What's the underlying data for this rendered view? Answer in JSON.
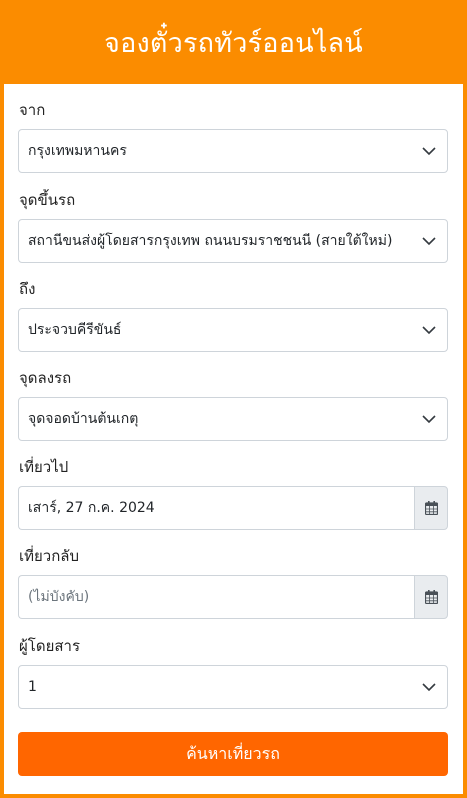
{
  "header": {
    "title": "จองตั๋วรถทัวร์ออนไลน์"
  },
  "form": {
    "from": {
      "label": "จาก",
      "value": "กรุงเทพมหานคร"
    },
    "pickup": {
      "label": "จุดขึ้นรถ",
      "value": "สถานีขนส่งผู้โดยสารกรุงเทพ ถนนบรมราชชนนี (สายใต้ใหม่)"
    },
    "to": {
      "label": "ถึง",
      "value": "ประจวบคีรีขันธ์"
    },
    "dropoff": {
      "label": "จุดลงรถ",
      "value": "จุดจอดบ้านต้นเกตุ"
    },
    "depart": {
      "label": "เที่ยวไป",
      "value": "เสาร์, 27 ก.ค. 2024"
    },
    "return": {
      "label": "เที่ยวกลับ",
      "placeholder": "(ไม่บังคับ)"
    },
    "passengers": {
      "label": "ผู้โดยสาร",
      "value": "1"
    },
    "search_label": "ค้นหาเที่ยวรถ"
  },
  "icons": {
    "dropdown": "chevron-down-icon",
    "calendar": "calendar-icon"
  },
  "colors": {
    "brand": "#fb8c00",
    "button": "#ff6600",
    "addon_bg": "#e9ecef"
  }
}
